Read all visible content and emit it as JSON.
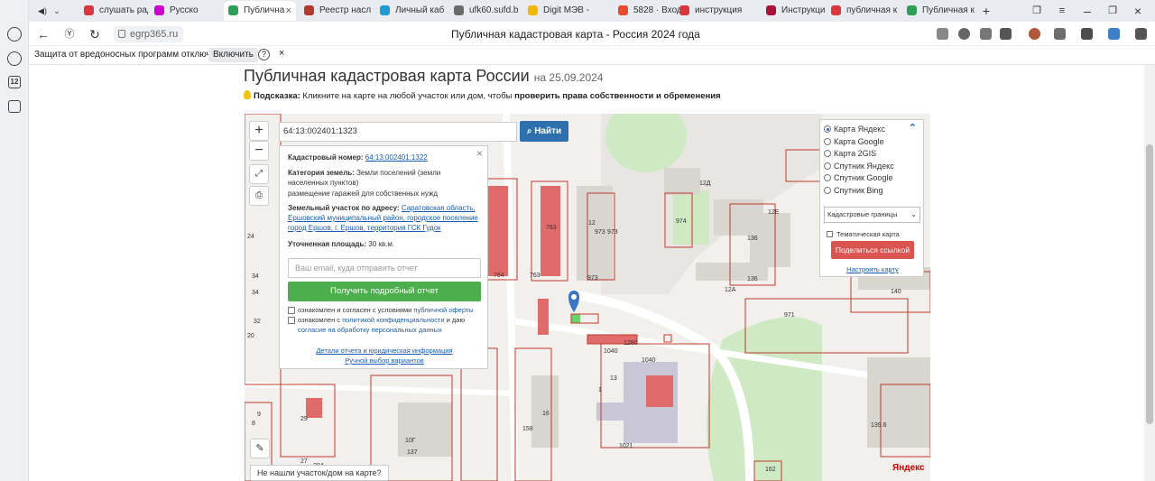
{
  "browser": {
    "tabs": [
      {
        "label": "слушать рад",
        "color": "#d9363e"
      },
      {
        "label": "Русско",
        "color": "#cc00cc"
      },
      {
        "label": "Публична",
        "color": "#2e9e56"
      },
      {
        "label": "Реестр насл",
        "color": "#b03a2e"
      },
      {
        "label": "Личный каб",
        "color": "#1e9ad6"
      },
      {
        "label": "ufk60.sufd.b",
        "color": "#6a6a6a"
      },
      {
        "label": "Digit МЭВ - ",
        "color": "#f2b705"
      },
      {
        "label": "5828 · Входя",
        "color": "#e8492f"
      },
      {
        "label": "инструкция",
        "color": "#d9363e"
      },
      {
        "label": "Инструкции",
        "color": "#a6123a"
      },
      {
        "label": "публичная к",
        "color": "#d9363e"
      },
      {
        "label": "Публичная к",
        "color": "#2e9e56"
      }
    ],
    "url": "egrp365.ru",
    "page_title": "Публичная кадастровая карта - Россия 2024 года",
    "protection_msg": "Защита от вредоносных программ отключена",
    "enable_label": "Включить",
    "help_glyph": "?",
    "close_glyph": "×",
    "rail_badge": "12"
  },
  "page": {
    "heading": "Публичная кадастровая карта России",
    "heading_date": "на 25.09.2024",
    "hint_label": "Подсказка:",
    "hint_text": " Кликните на карте на любой участок или дом, чтобы ",
    "hint_bold": "проверить права собственности и обременения"
  },
  "map": {
    "zoom_in": "+",
    "zoom_out": "−",
    "search_value": "64:13:002401:1323",
    "search_button": "Найти",
    "popup": {
      "cad_label": "Кадастровый номер:",
      "cad_value": "64:13:002401:1322",
      "cat_label": "Категория земель:",
      "cat_value": "Земли поселений (земли населенных пунктов)",
      "use": "размещение гаражей для собственных нужд",
      "addr_label": "Земельный участок по адресу:",
      "addr_value": "Саратовская область, Ершовский муниципальный район, городское поселение город Ершов, г. Ершов, территория ГСК Гудок",
      "area_label": "Уточненная площадь:",
      "area_value": "30 кв.м.",
      "email_placeholder": "Ваш email, куда отправить отчет",
      "get_report": "Получить подробный отчет",
      "agree1": "ознакомлен и согласен с условиями ",
      "agree1_link": "публичной оферты",
      "agree2": "ознакомлен с ",
      "agree2_link": "политикой конфиденциальности",
      "agree2_mid": " и даю ",
      "agree2_link2": "согласие на обработку персональных данных",
      "details_link": "Детали отчета и юридическая информация",
      "manual_link": "Ручной выбор вариантов"
    },
    "layers": {
      "options": [
        "Карта Яндекс",
        "Карта Google",
        "Карта 2GIS",
        "Спутник Яндекс",
        "Спутник Google",
        "Спутник Bing"
      ],
      "selected": "Карта Яндекс",
      "boundaries": "Кадастровые границы",
      "thematic": "Тематическая карта",
      "share": "Поделиться ссылкой",
      "setup": "Настроить карту"
    },
    "not_found": "Не нашли участок/дом на карте?",
    "brand": "Яндекс",
    "labels": [
      "24",
      "34",
      "34",
      "32",
      "20",
      "9",
      "29",
      "27",
      "304",
      "10Г",
      "137",
      "158",
      "16",
      "1040",
      "1",
      "13",
      "1021",
      "1280",
      "1040",
      "764",
      "763",
      "763",
      "973",
      "973",
      "973",
      "974",
      "12Д",
      "12Е",
      "136",
      "136",
      "12А",
      "971",
      "140",
      "139.6",
      "162",
      "12",
      "8"
    ]
  }
}
